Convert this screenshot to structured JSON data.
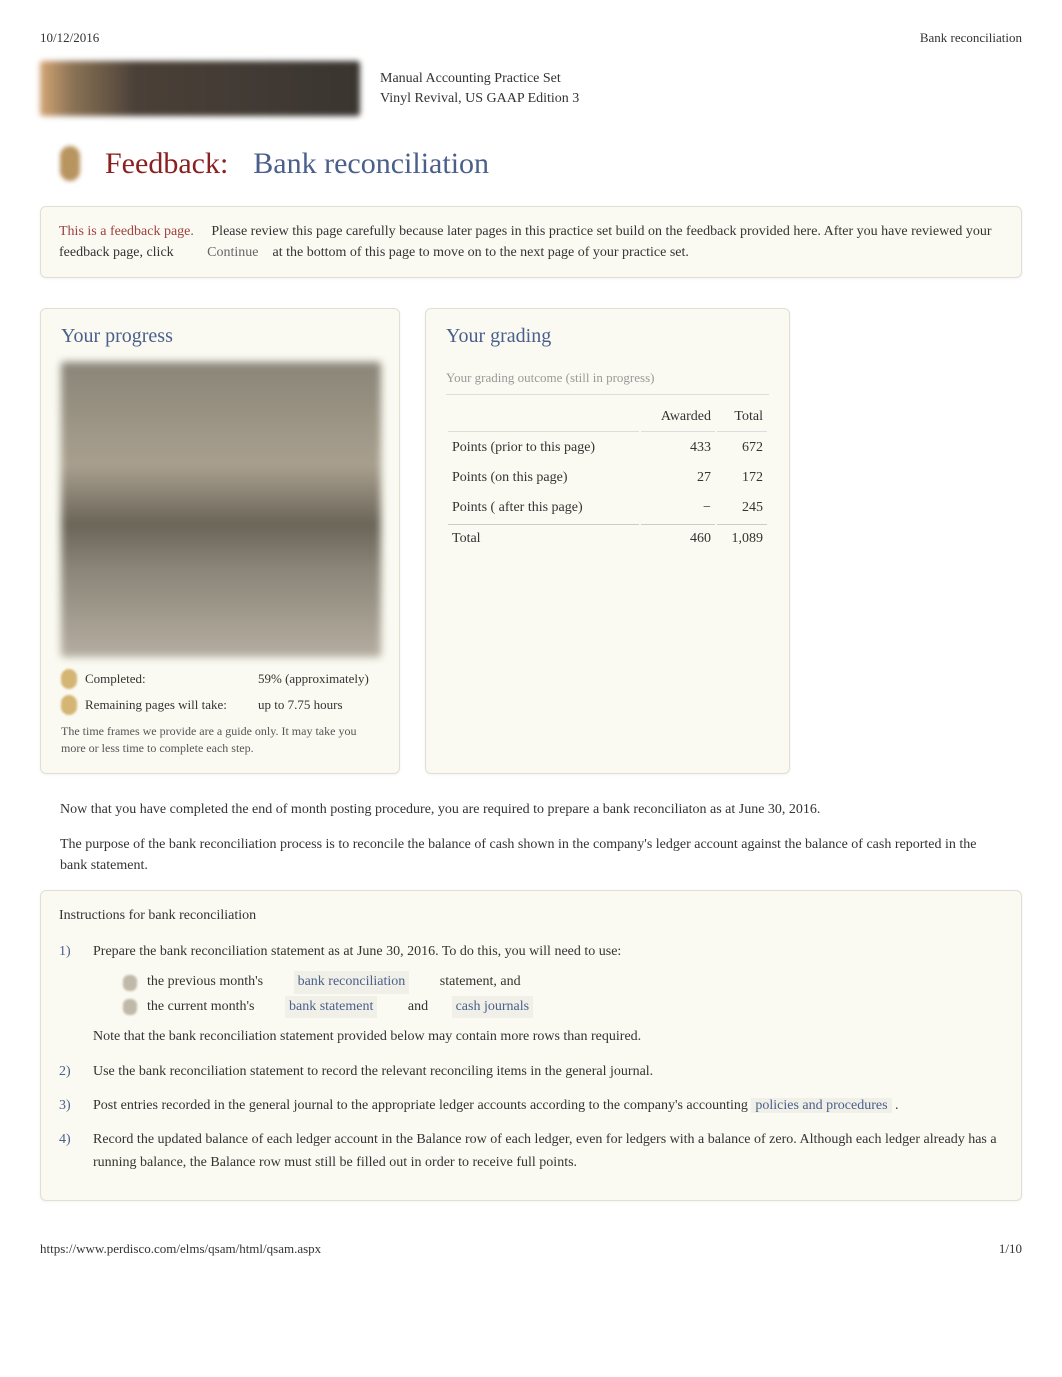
{
  "header": {
    "date": "10/12/2016",
    "page_title": "Bank reconciliation"
  },
  "practice_set": {
    "line1": "Manual Accounting Practice Set",
    "line2": "Vinyl Revival, US GAAP Edition 3"
  },
  "title": {
    "feedback": "Feedback:",
    "main": "Bank reconciliation"
  },
  "feedback_box": {
    "label": "This is a feedback page.",
    "text_before_continue": "Please review this page carefully because later pages in this practice set build on the feedback provided here. After you have reviewed your feedback page, click",
    "continue": "Continue",
    "text_after_continue": "at the bottom of this page to move on to the next page of your practice set."
  },
  "progress": {
    "title": "Your progress",
    "completed_label": "Completed:",
    "completed_value": "59% (approximately)",
    "remaining_label": "Remaining pages will take:",
    "remaining_value": "up to 7.75 hours",
    "note": "The time frames we provide are a guide only. It may take you more or less time to complete each step."
  },
  "grading": {
    "title": "Your grading",
    "subtitle": "Your grading outcome (still in progress)",
    "headers": {
      "blank": "",
      "awarded": "Awarded",
      "total": "Total"
    },
    "rows": [
      {
        "label": "Points (prior to this page)",
        "awarded": "433",
        "total": "672"
      },
      {
        "label": "Points (on this page)",
        "awarded": "27",
        "total": "172"
      },
      {
        "label": "Points ( after   this page)",
        "awarded": "−",
        "total": "245"
      },
      {
        "label": "Total",
        "awarded": "460",
        "total": "1,089"
      }
    ]
  },
  "body": {
    "para1": "Now that you have completed the end of month posting procedure, you are required to prepare a bank reconciliaton as at June 30, 2016.",
    "para2": "The purpose of the bank reconciliation process is to reconcile the balance of cash shown in the company's ledger account against the balance of cash reported in the bank statement."
  },
  "instructions": {
    "title": "Instructions for bank reconciliation",
    "items": [
      {
        "num": "1)",
        "text_intro": "Prepare the bank reconciliation statement as at June 30, 2016. To do this, you will need to use:",
        "bullets": [
          {
            "before": "the previous month's",
            "link": "bank reconciliation",
            "after": "statement, and"
          },
          {
            "before": "the current month's",
            "link": "bank statement",
            "mid": "and",
            "link2": "cash journals",
            "after": ""
          }
        ],
        "note": "Note that the bank reconciliation statement provided below may contain more rows than required."
      },
      {
        "num": "2)",
        "text": "Use the bank reconciliation statement to record the relevant reconciling items in the general journal."
      },
      {
        "num": "3)",
        "text_before": "Post entries recorded in the general journal to the appropriate ledger accounts according to the company's accounting",
        "link": "policies and procedures",
        "text_after": "."
      },
      {
        "num": "4)",
        "text": "Record the updated balance of each ledger account in the Balance row of each ledger, even for ledgers with a balance of zero. Although each ledger already has a running balance, the Balance row must still be filled out in order to receive full points."
      }
    ]
  },
  "footer": {
    "url": "https://www.perdisco.com/elms/qsam/html/qsam.aspx",
    "page": "1/10"
  }
}
